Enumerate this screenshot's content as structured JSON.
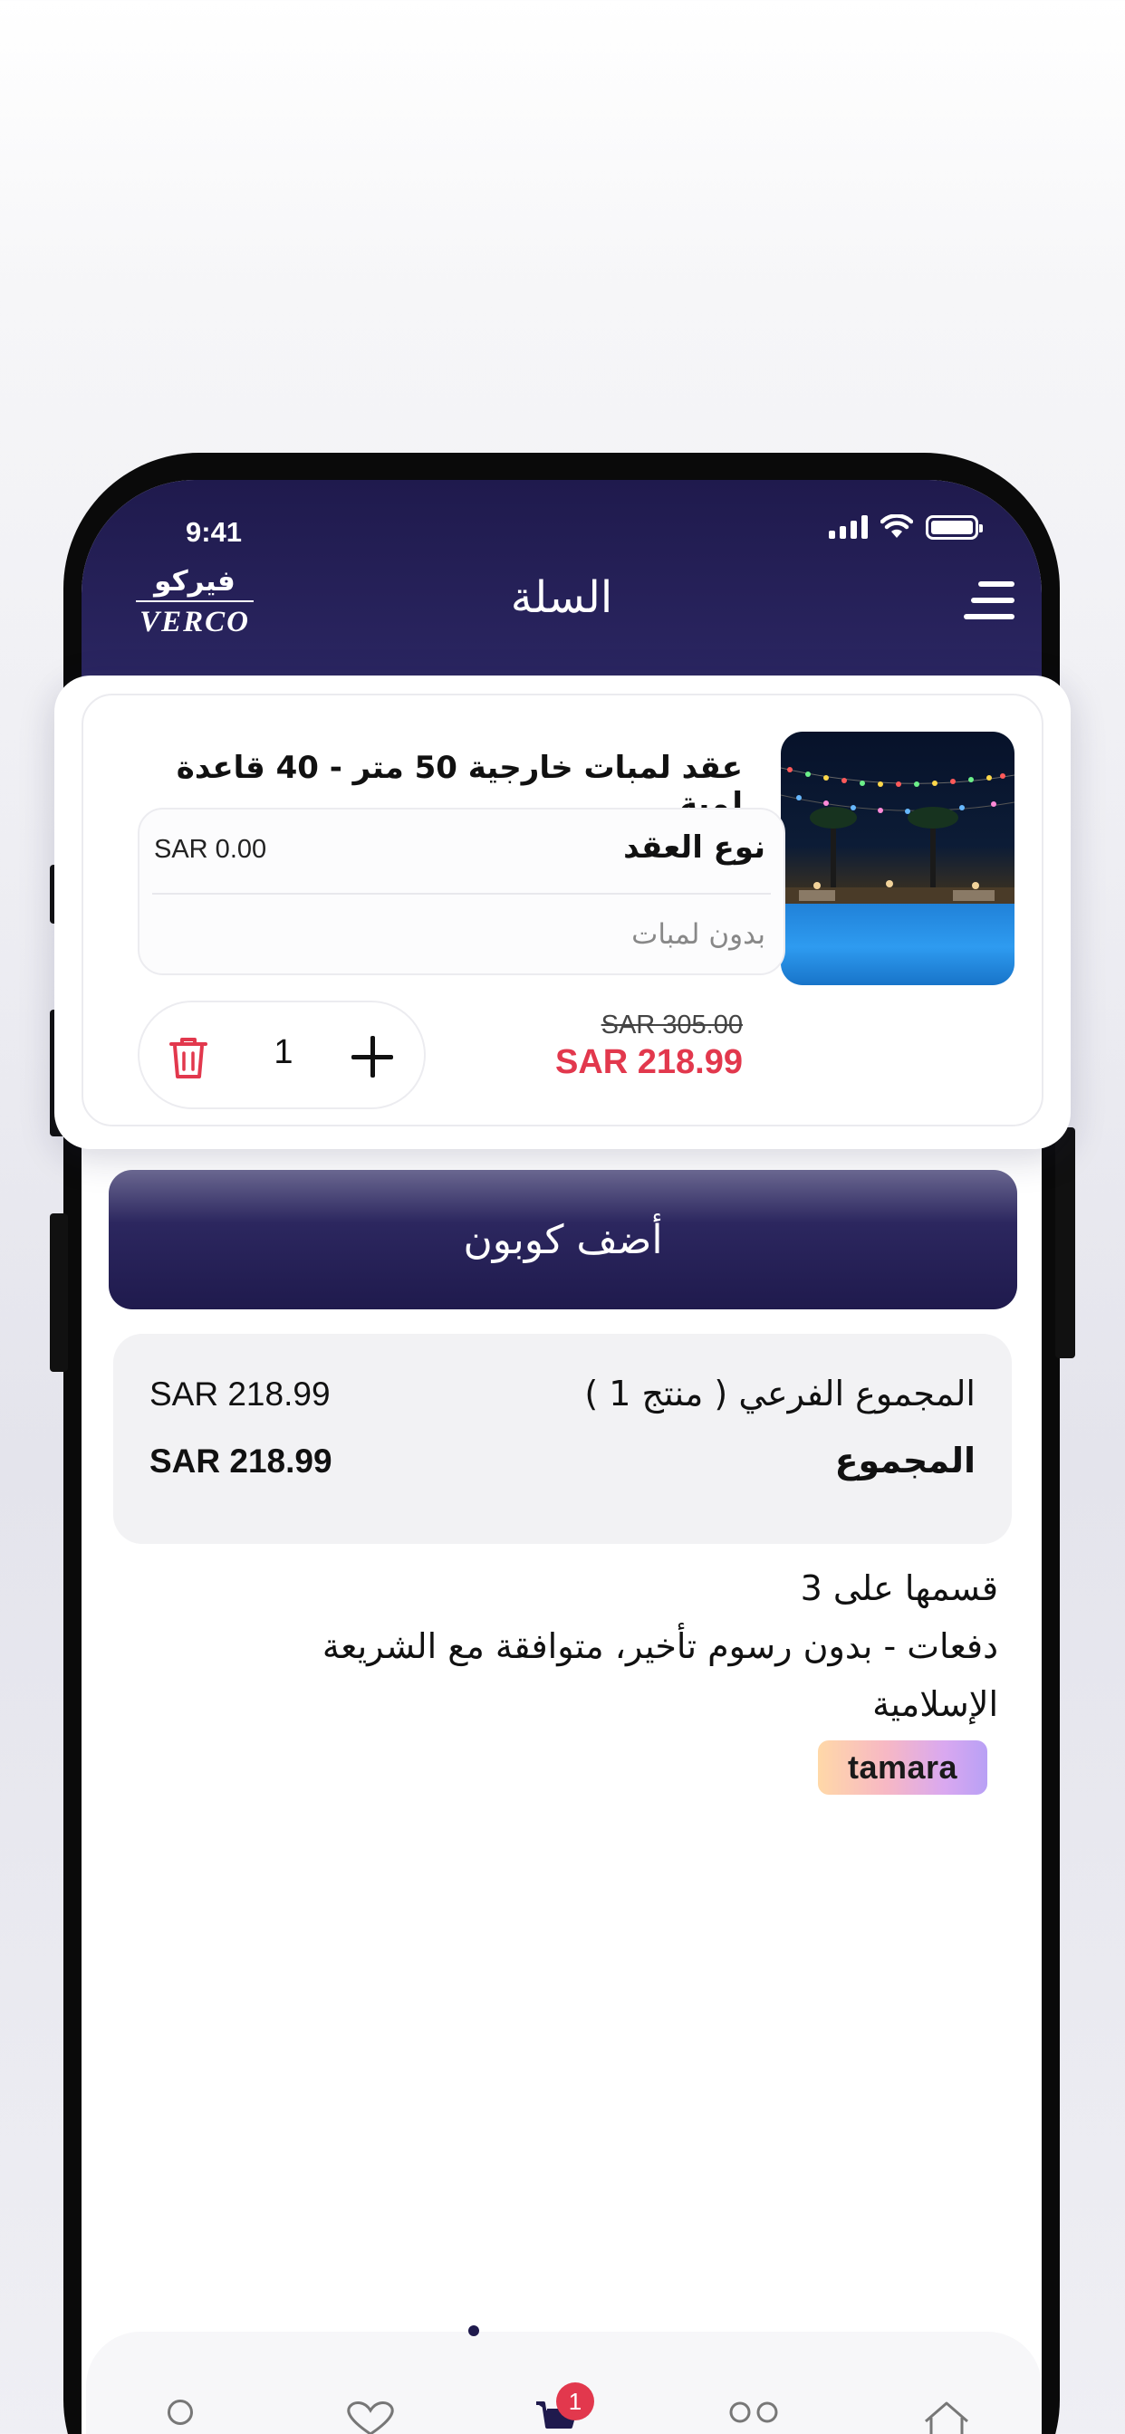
{
  "status_bar": {
    "time": "9:41"
  },
  "header": {
    "logo_arabic": "فيركو",
    "logo_latin": "VERCO",
    "title": "السلة"
  },
  "cart_item": {
    "title": "عقد لمبات خارجية 50 متر - 40 قاعدة لمبة",
    "option_name": "نوع العقد",
    "option_price": "SAR 0.00",
    "option_value": "بدون لمبات",
    "old_price": "SAR 305.00",
    "new_price": "SAR 218.99",
    "quantity": "1"
  },
  "coupon": {
    "label": "أضف كوبون"
  },
  "summary": {
    "subtotal_label": "المجموع الفرعي ( منتج 1 )",
    "subtotal_value": "SAR 218.99",
    "total_label": "المجموع",
    "total_value": "SAR 218.99"
  },
  "tamara": {
    "line1": "قسمها على 3",
    "line2": "دفعات - بدون رسوم تأخير، متوافقة مع الشريعة",
    "line3": "الإسلامية",
    "badge": "tamara"
  },
  "bottom_nav": {
    "cart_badge": "1"
  },
  "colors": {
    "brand_navy": "#1f1a4d",
    "sale_red": "#e2384d",
    "summary_bg": "#f2f2f4"
  }
}
